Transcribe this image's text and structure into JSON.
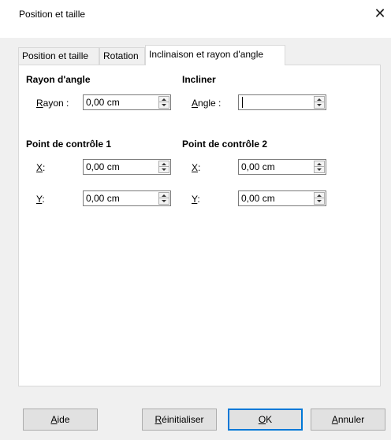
{
  "window": {
    "title": "Position et taille",
    "close_glyph": "✕"
  },
  "tabs": [
    {
      "label": "Position et taille",
      "active": false
    },
    {
      "label": "Rotation",
      "active": false
    },
    {
      "label": "Inclinaison et rayon d'angle",
      "active": true
    }
  ],
  "rayon_angle": {
    "title": "Rayon d'angle",
    "rayon_label_mnemonic": "R",
    "rayon_label_rest": "ayon :",
    "rayon_value": "0,00 cm"
  },
  "incliner": {
    "title": "Incliner",
    "angle_label_mnemonic": "A",
    "angle_label_rest": "ngle :",
    "angle_value": ""
  },
  "point1": {
    "title": "Point de contrôle 1",
    "x_label_mnemonic": "X",
    "x_label_rest": ":",
    "x_value": "0,00 cm",
    "y_label_mnemonic": "Y",
    "y_label_rest": ":",
    "y_value": "0,00 cm"
  },
  "point2": {
    "title": "Point de contrôle 2",
    "x_label_mnemonic": "X",
    "x_label_rest": ":",
    "x_value": "0,00 cm",
    "y_label_mnemonic": "Y",
    "y_label_rest": ":",
    "y_value": "0,00 cm"
  },
  "buttons": {
    "help_mnemonic": "A",
    "help_rest": "ide",
    "reset_mnemonic": "R",
    "reset_rest": "éinitialiser",
    "ok_mnemonic": "O",
    "ok_rest": "K",
    "cancel_mnemonic": "A",
    "cancel_rest": "nnuler"
  },
  "colors": {
    "default_button_border": "#0078d7",
    "panel_bg": "#ffffff",
    "dialog_bg": "#f0f0f0"
  }
}
